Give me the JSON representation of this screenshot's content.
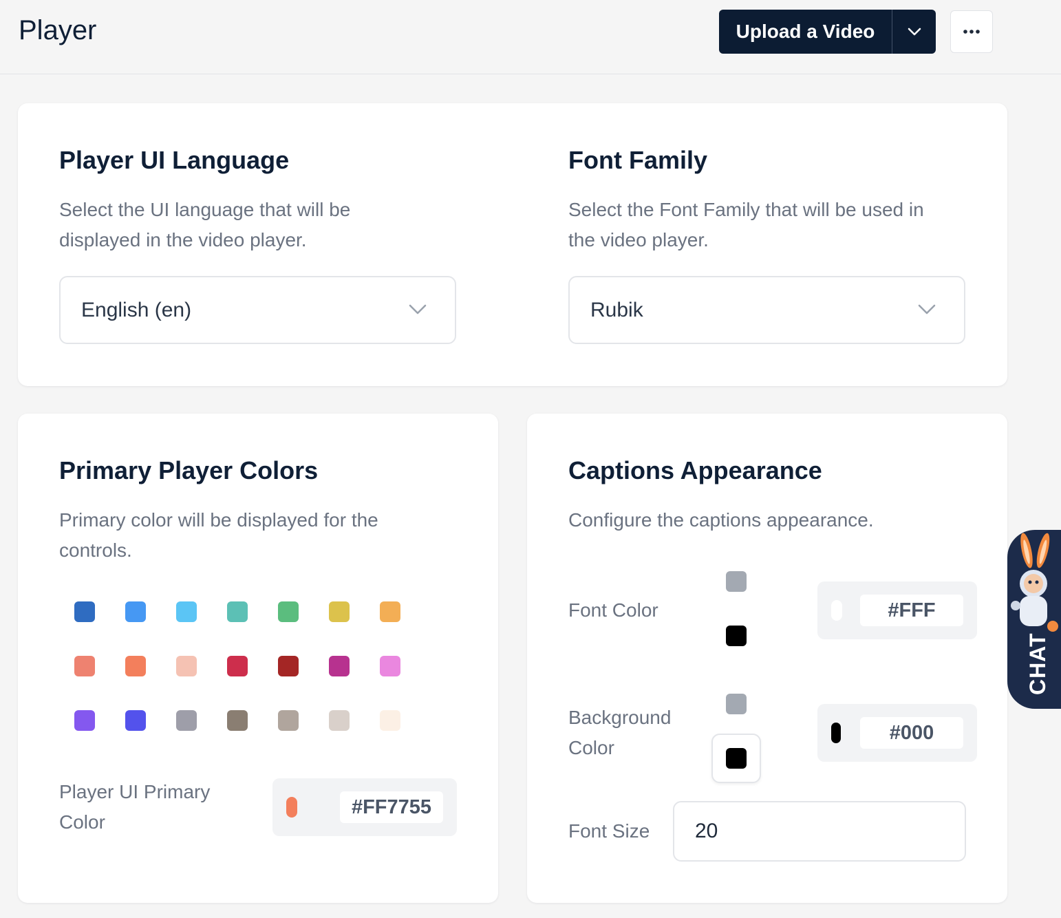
{
  "header": {
    "title": "Player",
    "upload_label": "Upload a Video"
  },
  "language_card": {
    "title": "Player UI Language",
    "description_line1": "Select the UI language that will be",
    "description_line2": "displayed in the video player.",
    "selected": "English (en)"
  },
  "font_card": {
    "title": "Font Family",
    "description_line1": "Select the Font Family that will be used in",
    "description_line2": "the video player.",
    "selected": "Rubik"
  },
  "colors_card": {
    "title": "Primary Player Colors",
    "description_line1": "Primary color will be displayed for the",
    "description_line2": "controls.",
    "palette": [
      [
        "#2f6cc1",
        "#4698f3",
        "#5bc5f5",
        "#5cc0b5",
        "#5bbd7e",
        "#dcc24c",
        "#f3ae55"
      ],
      [
        "#ee8270",
        "#f37f5c",
        "#f5c2b3",
        "#cd2e4c",
        "#a42625",
        "#b7328f",
        "#ea87df"
      ],
      [
        "#8458ef",
        "#5352ec",
        "#9e9ea9",
        "#8a7e72",
        "#b0a59d",
        "#d9d0ca",
        "#fcf0e5"
      ]
    ],
    "primary_label_line1": "Player UI Primary",
    "primary_label_line2": "Color",
    "primary_hex": "#FF7755",
    "primary_color": "#f37f5c"
  },
  "captions_card": {
    "title": "Captions Appearance",
    "description": "Configure the captions appearance.",
    "font_color_label": "Font Color",
    "font_color_hex": "#FFF",
    "bg_color_label_line1": "Background",
    "bg_color_label_line2": "Color",
    "bg_color_hex": "#000",
    "font_size_label": "Font Size",
    "font_size_value": "20",
    "swatch_gray": "#a3a9b2",
    "swatch_black": "#000000"
  },
  "chat": {
    "label": "CHAT"
  }
}
